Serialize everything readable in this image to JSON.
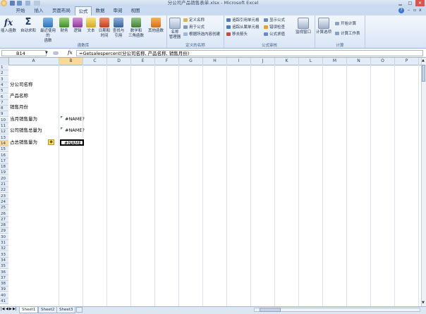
{
  "window": {
    "title": "分公司产品销售表单.xlsx - Microsoft Excel",
    "controls": [
      "minimize-icon",
      "maximize-icon",
      "close-icon"
    ]
  },
  "ribbon": {
    "tabs": [
      {
        "label": "开始"
      },
      {
        "label": "插入"
      },
      {
        "label": "页面布局"
      },
      {
        "label": "公式",
        "active": true
      },
      {
        "label": "数据"
      },
      {
        "label": "审阅"
      },
      {
        "label": "视图"
      }
    ],
    "function_library": {
      "group_label": "函数库",
      "insert_function": "插入函数",
      "autosum": "自动求和",
      "recent_line1": "最近使用的",
      "recent_line2": "函数",
      "financial": "财务",
      "logical": "逻辑",
      "text": "文本",
      "datetime_line1": "日期和",
      "datetime_line2": "时间",
      "lookup_line1": "查找与",
      "lookup_line2": "引用",
      "math_line1": "数学和",
      "math_line2": "三角函数",
      "more": "其他函数"
    },
    "defined_names": {
      "group_label": "定义的名称",
      "name_manager_line1": "名称",
      "name_manager_line2": "管理器",
      "define_name": "定义名称",
      "use_in_formula": "用于公式",
      "create_from_selection": "根据所选内容创建"
    },
    "formula_auditing": {
      "group_label": "公式审核",
      "trace_precedents": "追踪引用单元格",
      "trace_dependents": "追踪从属单元格",
      "remove_arrows": "移去箭头",
      "show_formulas": "显示公式",
      "error_checking": "错误检查",
      "evaluate_formula": "公式求值",
      "watch_window": "监视窗口"
    },
    "calculation": {
      "group_label": "计算",
      "calc_options": "计算选项",
      "calc_now": "开始计算",
      "calc_sheet": "计算工作表"
    }
  },
  "formula_bar": {
    "name_box": "B14",
    "fx": "fx",
    "formula": "=Getsalespercent(分公司名称, 产品名称, 销售月份)"
  },
  "grid": {
    "columns": [
      "A",
      "B",
      "C",
      "D",
      "E",
      "F",
      "G",
      "H",
      "I",
      "J",
      "K",
      "L",
      "M",
      "N",
      "O",
      "P"
    ],
    "active_cell": "B14",
    "cells": [
      {
        "ref": "A4",
        "row": 4,
        "text": "分公司名称"
      },
      {
        "ref": "A6",
        "row": 6,
        "text": "产品名称"
      },
      {
        "ref": "A8",
        "row": 8,
        "text": "销售月份"
      },
      {
        "ref": "A10",
        "row": 10,
        "text": "当月销售量为"
      },
      {
        "ref": "B10",
        "row": 10,
        "text": "#NAME?"
      },
      {
        "ref": "A12",
        "row": 12,
        "text": "公司销售总量为"
      },
      {
        "ref": "B12",
        "row": 12,
        "text": "#NAME?"
      },
      {
        "ref": "A14",
        "row": 14,
        "text": "占总销售量为"
      },
      {
        "ref": "B14",
        "row": 14,
        "text": "#NAME?"
      }
    ]
  },
  "sheets": [
    {
      "label": "Sheet1",
      "active": true
    },
    {
      "label": "Sheet2"
    },
    {
      "label": "Sheet3"
    }
  ]
}
